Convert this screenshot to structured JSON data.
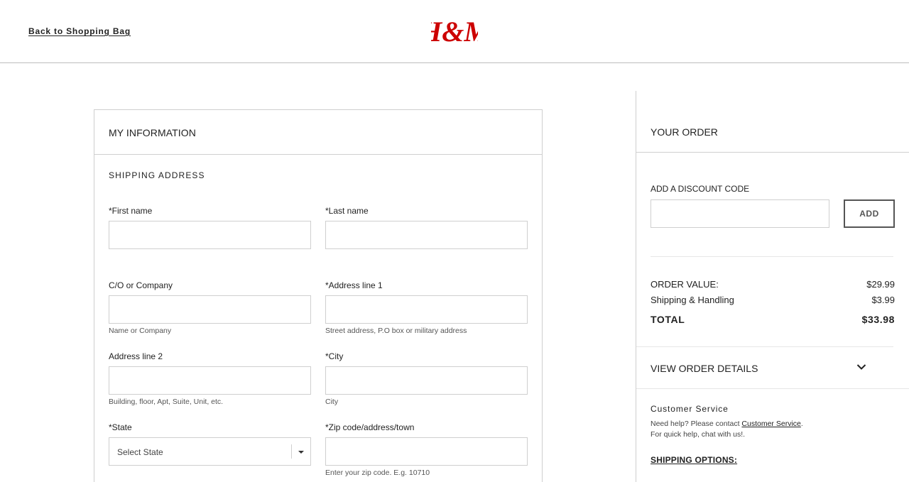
{
  "header": {
    "back_link": "Back to Shopping Bag",
    "brand": "H&M",
    "brand_color": "#cc0000"
  },
  "form": {
    "title": "MY INFORMATION",
    "section": "SHIPPING ADDRESS",
    "fields": {
      "first_name": {
        "label": "*First name",
        "value": ""
      },
      "last_name": {
        "label": "*Last name",
        "value": ""
      },
      "company": {
        "label": "C/O or Company",
        "value": "",
        "hint": "Name or Company"
      },
      "address1": {
        "label": "*Address line 1",
        "value": "",
        "hint": "Street address, P.O box or military address"
      },
      "address2": {
        "label": "Address line 2",
        "value": "",
        "hint": "Building, floor, Apt, Suite, Unit, etc."
      },
      "city": {
        "label": "*City",
        "value": "",
        "hint": "City"
      },
      "state": {
        "label": "*State",
        "selected": "Select State"
      },
      "zip": {
        "label": "*Zip code/address/town",
        "value": "",
        "hint": "Enter your zip code. E.g. 10710"
      }
    }
  },
  "order": {
    "title": "YOUR ORDER",
    "discount_label": "ADD A DISCOUNT CODE",
    "discount_value": "",
    "add_button": "ADD",
    "order_value_label": "ORDER VALUE:",
    "order_value": "$29.99",
    "shipping_label": "Shipping & Handling",
    "shipping_value": "$3.99",
    "total_label": "TOTAL",
    "total_value": "$33.98",
    "view_details": "VIEW ORDER DETAILS",
    "customer_service": {
      "title": "Customer Service",
      "line1_prefix": "Need help? Please contact ",
      "line1_link": "Customer Service",
      "line1_suffix": ".",
      "line2": "For quick help, chat with us!."
    },
    "shipping_options": "SHIPPING OPTIONS:"
  }
}
